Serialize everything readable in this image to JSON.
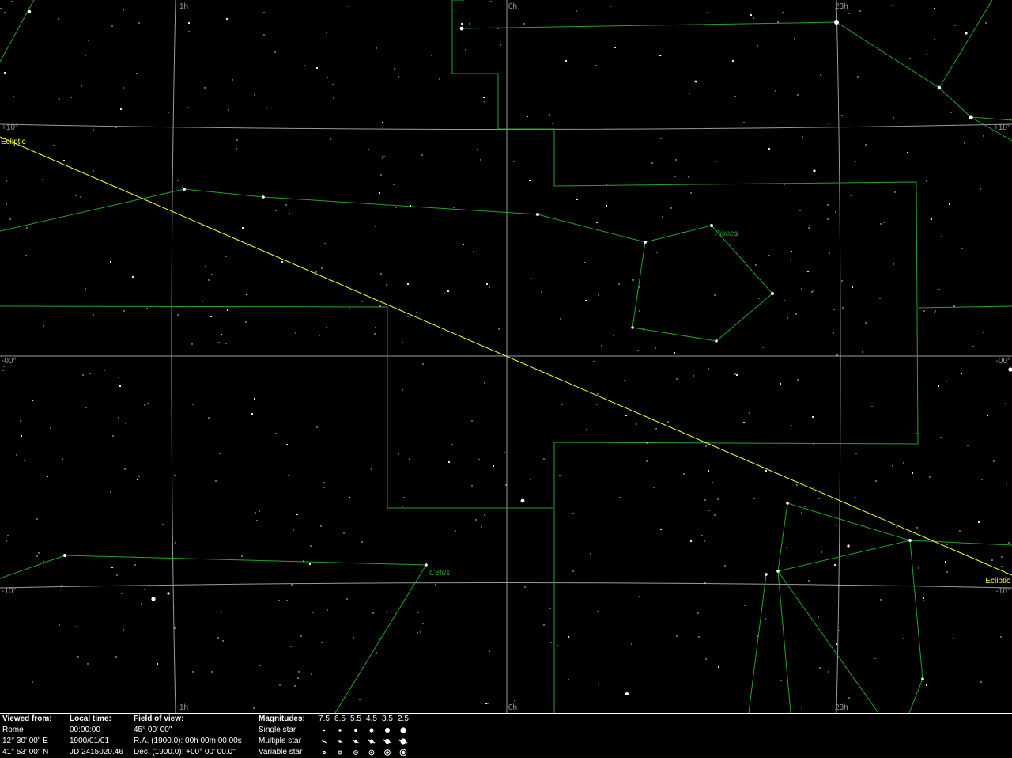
{
  "grid_labels": {
    "ra_top": [
      "1h",
      "0h",
      "23h"
    ],
    "ra_bottom": [
      "1h",
      "0h",
      "23h"
    ],
    "dec": [
      "+10°",
      "-00°",
      "-10°"
    ]
  },
  "ecliptic_label": "Ecliptic",
  "constellations": [
    "Pisces",
    "Cetus"
  ],
  "colors": {
    "background": "#000000",
    "grid": "#9a9a9a",
    "constellation": "#1fa52a",
    "ecliptic": "#ffff33",
    "stars": "#ffffff",
    "text": "#ffffff"
  },
  "info": {
    "viewed_from": {
      "header": "Viewed from:",
      "place": "Rome",
      "longitude": "12° 30' 00\" E",
      "latitude": "41° 53' 00\" N"
    },
    "local_time": {
      "header": "Local time:",
      "time": "00:00:00",
      "date": "1900/01/01",
      "jd": "JD 2415020.46"
    },
    "field_of_view": {
      "header": "Field of view:",
      "fov": "45° 00' 00\"",
      "ra": "R.A. (1900.0): 00h 00m 00.00s",
      "dec": "Dec. (1900.0): +00° 00' 00.0\""
    },
    "magnitudes": {
      "header": "Magnitudes:",
      "values": [
        "7.5",
        "6.5",
        "5.5",
        "4.5",
        "3.5",
        "2.5"
      ],
      "rows": [
        "Single star",
        "Multiple star",
        "Variable star"
      ]
    }
  }
}
